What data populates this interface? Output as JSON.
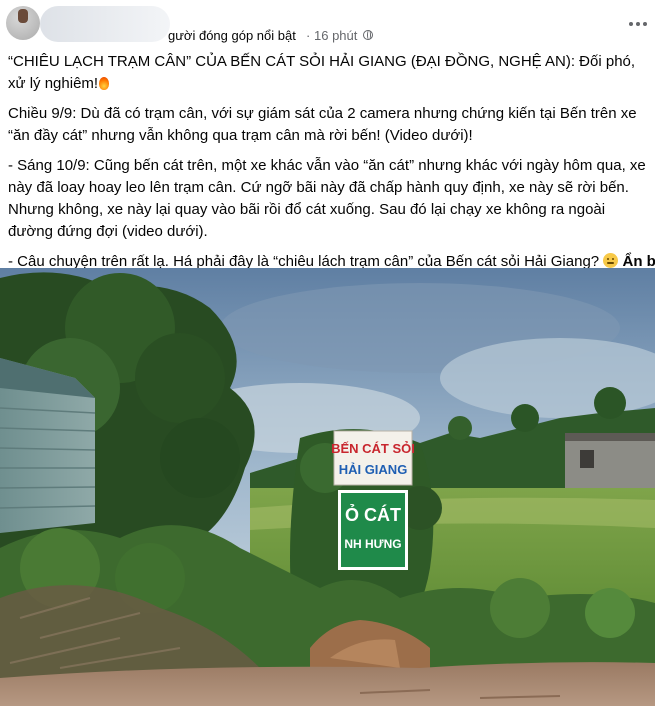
{
  "header": {
    "badge": "gười đóng góp nổi bật",
    "separator": "·",
    "time": "16 phút"
  },
  "post": {
    "title": "“CHIÊU LẠCH TRẠM CÂN” CỦA BẾN CÁT SỎI HẢI GIANG (ĐẠI ĐỒNG, NGHỆ AN): Đối phó, xử lý nghiêm!",
    "para1": "Chiều 9/9: Dù đã có trạm cân, với sự giám sát của 2 camera nhưng chứng kiến tại Bến trên xe “ăn đầy cát” nhưng vẫn không qua trạm cân mà rời bến! (Video dưới)!",
    "para2": "- Sáng 10/9: Cũng bến cát trên, một xe khác vẫn vào “ăn cát” nhưng khác với ngày hôm qua, xe này đã loay hoay leo lên trạm cân. Cứ ngỡ bãi này đã chấp hành quy định, xe này sẽ rời bến. Nhưng không, xe này lại quay vào bãi rồi đổ cát xuống. Sau đó lại chạy xe không ra ngoài đường đứng đợi (video dưới).",
    "para3": "- Câu chuyện trên rất lạ. Há phải đây là “chiêu lách trạm cân” của Bến cát sỏi Hải Giang?",
    "see_more": "Ẩn bớt"
  },
  "photo": {
    "sign_top_line1": "BẾN CÁT SỎI",
    "sign_top_line2": "HẢI GIANG",
    "sign_bottom_line1": "Ỏ CÁT",
    "sign_bottom_line2": "NH HƯNG"
  },
  "icons": {
    "fire": "fire-emoji-icon",
    "smiley": "flushed-face-emoji-icon",
    "more": "more-options-icon",
    "privacy": "globe-icon"
  }
}
